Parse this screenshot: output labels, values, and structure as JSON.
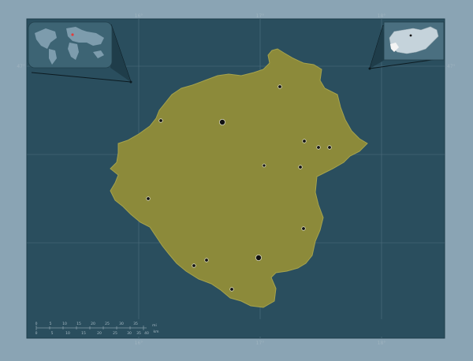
{
  "map": {
    "background_color": "#8aa4b4",
    "frame_color": "#2a4e5e",
    "region_fill": "#8c8a3a",
    "region_stroke": "#a6a34c",
    "graticule_color": "#5f7d8c",
    "settlement_marker": "black-dot",
    "inset_world": "world-overview-map",
    "inset_country": "hungary-locator-map"
  },
  "ticks": {
    "top": [
      "16°",
      "17°",
      "18°"
    ],
    "bottom": [
      "16°",
      "17°",
      "18°"
    ],
    "left": [
      "47°"
    ],
    "right": [
      "47°"
    ]
  },
  "scale_bar": {
    "top_labels": [
      "0",
      "5",
      "10",
      "15",
      "20",
      "25",
      "30",
      "35",
      "mi"
    ],
    "bottom_labels": [
      "0",
      "5",
      "10",
      "15",
      "20",
      "25",
      "30",
      "35",
      "40",
      "km"
    ]
  }
}
